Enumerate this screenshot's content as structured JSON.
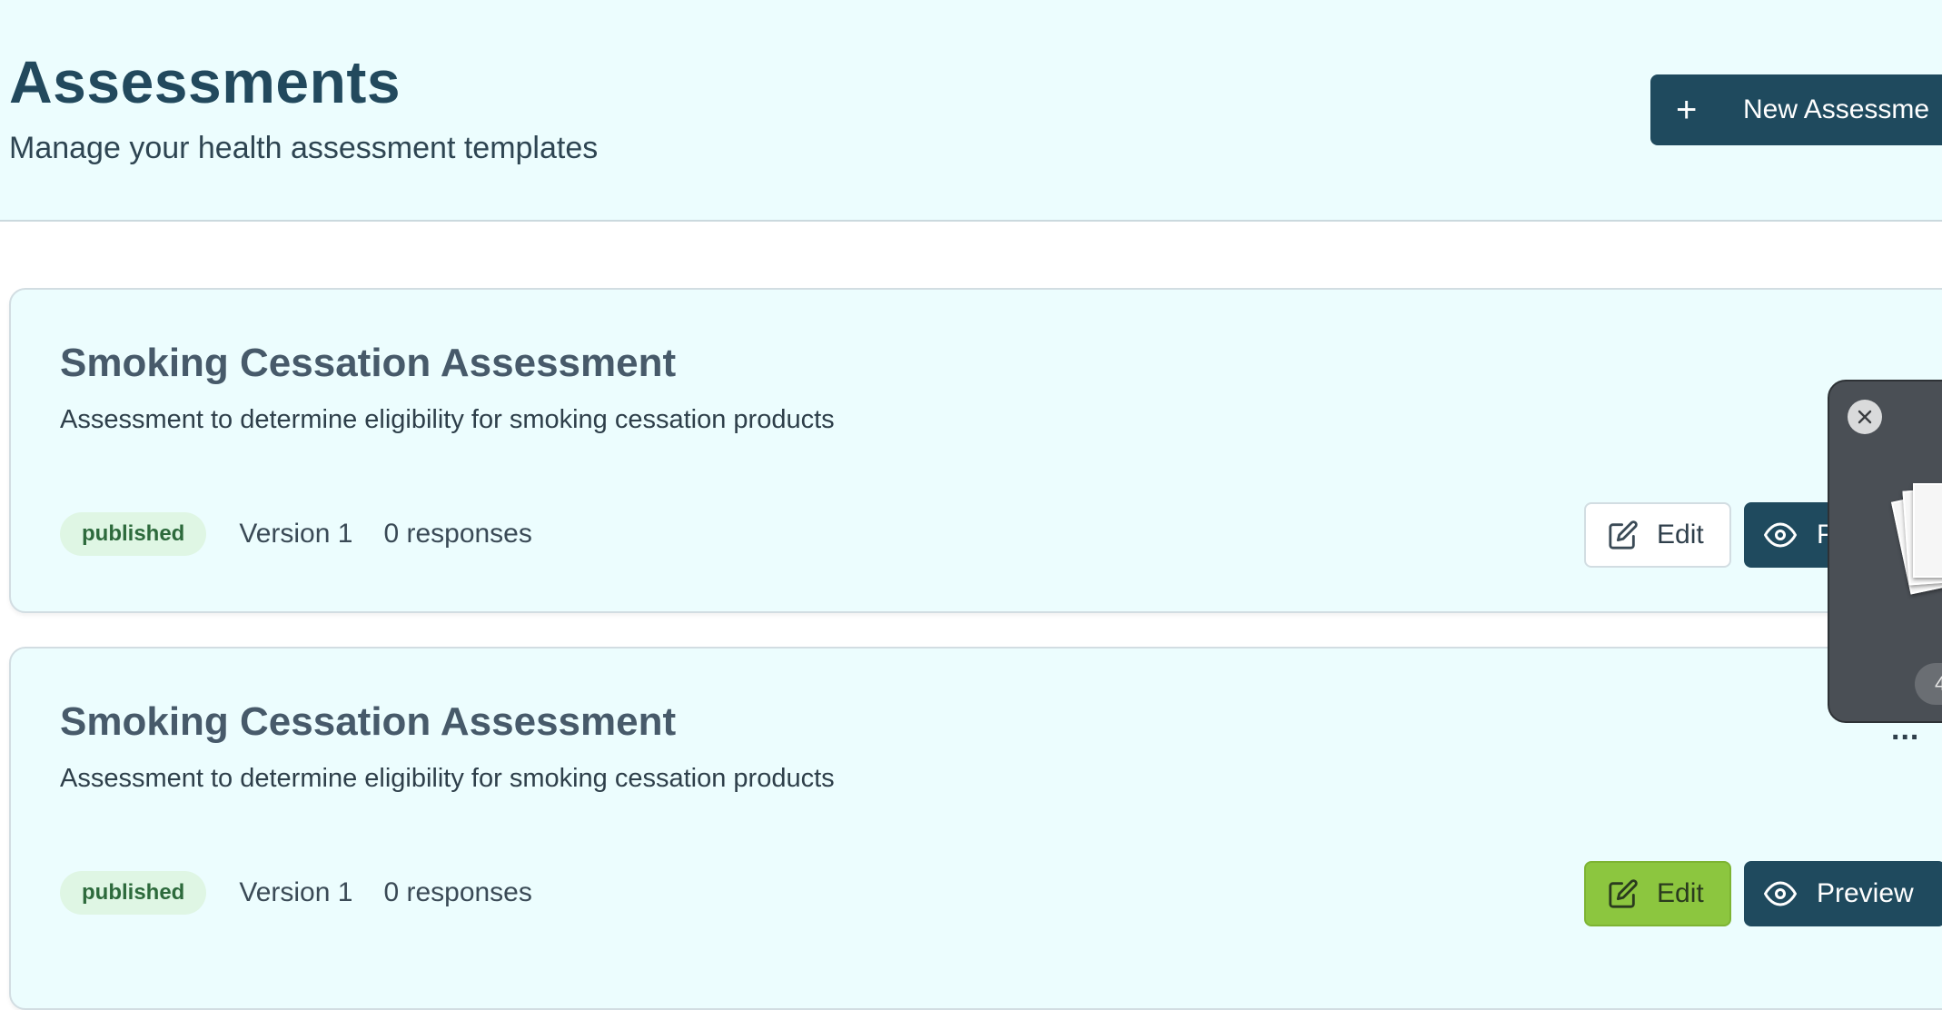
{
  "header": {
    "title": "Assessments",
    "subtitle": "Manage your health assessment templates",
    "new_button_label": "New Assessme",
    "new_button_icon": "plus-icon"
  },
  "cards": [
    {
      "title": "Smoking Cessation Assessment",
      "description": "Assessment to determine eligibility for smoking cessation products",
      "status": "published",
      "version": "Version 1",
      "responses": "0 responses",
      "more_label": "...",
      "edit_label": "Edit",
      "preview_label": "P",
      "edit_state": "default"
    },
    {
      "title": "Smoking Cessation Assessment",
      "description": "Assessment to determine eligibility for smoking cessation products",
      "status": "published",
      "version": "Version 1",
      "responses": "0 responses",
      "more_label": "...",
      "edit_label": "Edit",
      "preview_label": "Preview",
      "edit_state": "highlighted"
    }
  ],
  "popup": {
    "pill_label": "4"
  },
  "colors": {
    "primary": "#1f4a5e",
    "header_bg": "#ecfdfe",
    "badge_bg": "#dff6e4",
    "badge_text": "#2d6a3c",
    "highlight_green": "#8cc63f"
  }
}
